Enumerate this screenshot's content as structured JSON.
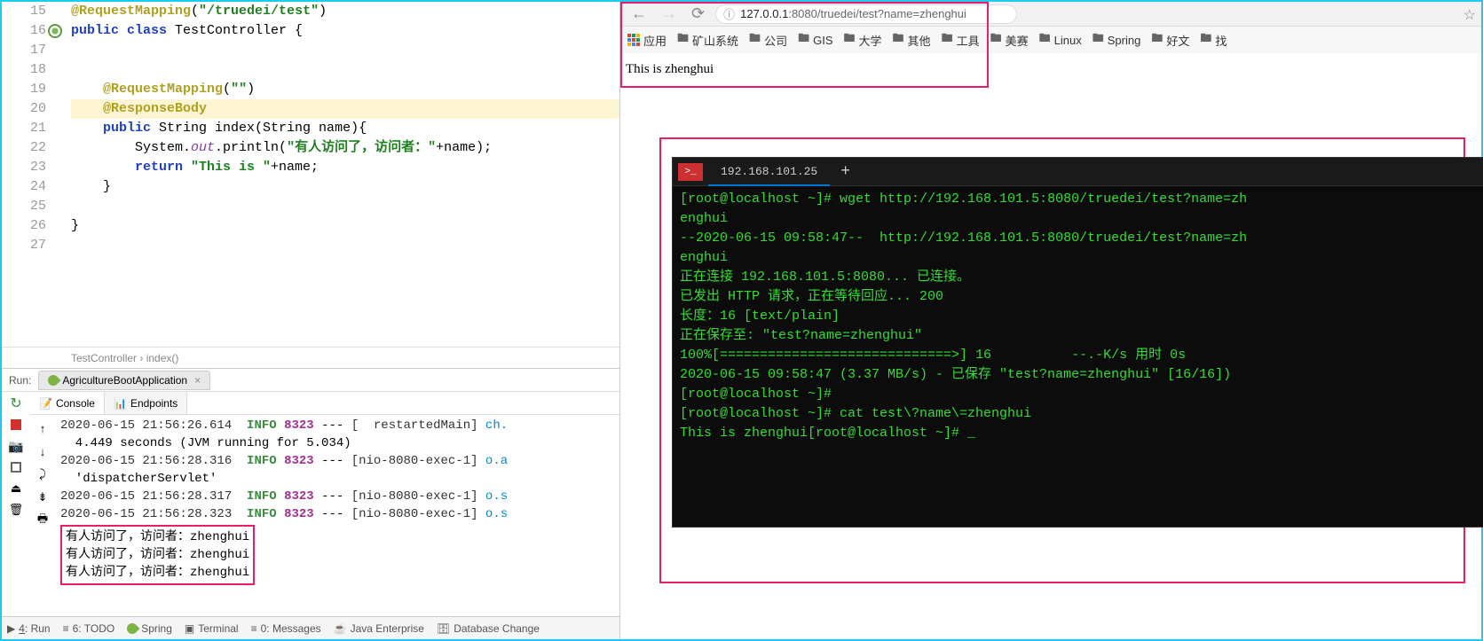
{
  "ide": {
    "gutter_lines": [
      "15",
      "16",
      "17",
      "18",
      "19",
      "20",
      "21",
      "22",
      "23",
      "24",
      "25",
      "26",
      "27"
    ],
    "code": {
      "l15_ann": "@RequestMapping",
      "l15_str": "\"/truedei/test\"",
      "l16_kw1": "public ",
      "l16_kw2": "class ",
      "l16_cls": "TestController {",
      "l19_ann": "@RequestMapping",
      "l19_str": "\"\"",
      "l20_ann": "@ResponseBody",
      "l21_kw": "public ",
      "l21_sig": "String index(String name){",
      "l22_pre": "        System.",
      "l22_out": "out",
      "l22_mid": ".println(",
      "l22_str": "\"有人访问了，访问者：\"",
      "l22_end": "+name);",
      "l23_kw": "return ",
      "l23_str": "\"This is \"",
      "l23_end": "+name;",
      "l24": "    }",
      "l26": "}"
    },
    "breadcrumb": {
      "cls": "TestController",
      "sep": " › ",
      "method": "index()"
    },
    "run_label": "Run:",
    "run_tab": "AgricultureBootApplication",
    "console_tab": "Console",
    "endpoints_tab": "Endpoints",
    "log_lines": [
      {
        "ts": "2020-06-15 21:56:26.614",
        "level": "INFO",
        "pid": "8323",
        "thread": "[  restartedMain]",
        "cls": "ch."
      },
      {
        "plain": "  4.449 seconds (JVM running for 5.034)"
      },
      {
        "ts": "2020-06-15 21:56:28.316",
        "level": "INFO",
        "pid": "8323",
        "thread": "[nio-8080-exec-1]",
        "cls": "o.a"
      },
      {
        "plain": "  'dispatcherServlet'"
      },
      {
        "ts": "2020-06-15 21:56:28.317",
        "level": "INFO",
        "pid": "8323",
        "thread": "[nio-8080-exec-1]",
        "cls": "o.s"
      },
      {
        "ts": "2020-06-15 21:56:28.323",
        "level": "INFO",
        "pid": "8323",
        "thread": "[nio-8080-exec-1]",
        "cls": "o.s"
      }
    ],
    "highlighted_output": [
      "有人访问了，访问者：zhenghui",
      "有人访问了，访问者：zhenghui",
      "有人访问了，访问者：zhenghui"
    ],
    "bottom_bar": {
      "run": "4: Run",
      "todo": "6: TODO",
      "spring": "Spring",
      "terminal": "Terminal",
      "messages": "0: Messages",
      "javaee": "Java Enterprise",
      "db": "Database Change"
    }
  },
  "browser": {
    "url_host": "127.0.0.1",
    "url_rest": ":8080/truedei/test?name=zhenghui",
    "bookmarks": [
      "应用",
      "矿山系统",
      "公司",
      "GIS",
      "大学",
      "其他",
      "工具",
      "美赛",
      "Linux",
      "Spring",
      "好文",
      "找"
    ],
    "page_text": "This is zhenghui"
  },
  "terminal": {
    "tab_title": "192.168.101.25",
    "lines": [
      "[root@localhost ~]# wget http://192.168.101.5:8080/truedei/test?name=zh",
      "enghui",
      "--2020-06-15 09:58:47--  http://192.168.101.5:8080/truedei/test?name=zh",
      "enghui",
      "正在连接 192.168.101.5:8080... 已连接。",
      "已发出 HTTP 请求，正在等待回应... 200",
      "长度：16 [text/plain]",
      "正在保存至: \"test?name=zhenghui\"",
      "",
      "100%[=============================>] 16          --.-K/s 用时 0s",
      "",
      "2020-06-15 09:58:47 (3.37 MB/s) - 已保存 \"test?name=zhenghui\" [16/16])",
      "",
      "[root@localhost ~]#",
      "[root@localhost ~]# cat test\\?name\\=zhenghui",
      "This is zhenghui[root@localhost ~]# _"
    ]
  }
}
